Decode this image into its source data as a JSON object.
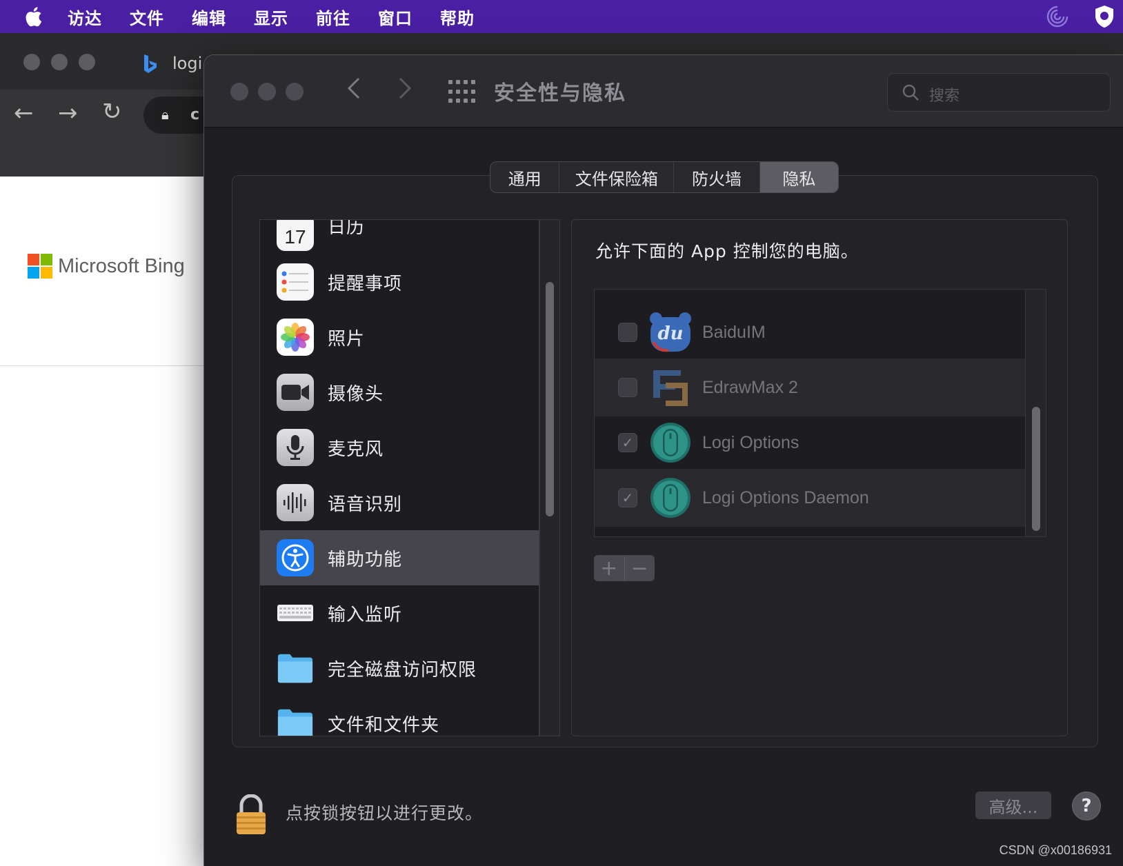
{
  "menubar": {
    "items": [
      "访达",
      "文件",
      "编辑",
      "显示",
      "前往",
      "窗口",
      "帮助"
    ],
    "bg_color": "#4a1fa3"
  },
  "browser": {
    "tab_title": "logi",
    "address_text": "c",
    "page": {
      "brand": "Microsoft Bing"
    }
  },
  "prefs": {
    "title": "安全性与隐私",
    "search_placeholder": "搜索",
    "tabs": [
      {
        "label": "通用",
        "active": false
      },
      {
        "label": "文件保险箱",
        "active": false
      },
      {
        "label": "防火墙",
        "active": false
      },
      {
        "label": "隐私",
        "active": true
      }
    ],
    "categories": [
      {
        "label": "日历",
        "icon": "calendar-icon",
        "calendar_day": "17"
      },
      {
        "label": "提醒事项",
        "icon": "reminders-icon"
      },
      {
        "label": "照片",
        "icon": "photos-icon"
      },
      {
        "label": "摄像头",
        "icon": "camera-icon"
      },
      {
        "label": "麦克风",
        "icon": "microphone-icon"
      },
      {
        "label": "语音识别",
        "icon": "speech-recognition-icon"
      },
      {
        "label": "辅助功能",
        "icon": "accessibility-icon",
        "selected": true
      },
      {
        "label": "输入监听",
        "icon": "keyboard-icon"
      },
      {
        "label": "完全磁盘访问权限",
        "icon": "folder-icon"
      },
      {
        "label": "文件和文件夹",
        "icon": "folder-icon"
      }
    ],
    "description": "允许下面的 App 控制您的电脑。",
    "apps": [
      {
        "name": "BaiduIM",
        "checked": false,
        "icon": "baidu-im-icon"
      },
      {
        "name": "EdrawMax 2",
        "checked": false,
        "icon": "edrawmax-icon"
      },
      {
        "name": "Logi Options",
        "checked": true,
        "icon": "logi-mouse-icon"
      },
      {
        "name": "Logi Options Daemon",
        "checked": true,
        "icon": "logi-mouse-icon"
      }
    ],
    "add_label": "+",
    "remove_label": "−",
    "lock_text": "点按锁按钮以进行更改。",
    "advanced_label": "高级...",
    "help_label": "?"
  },
  "watermark": "CSDN @x00186931"
}
